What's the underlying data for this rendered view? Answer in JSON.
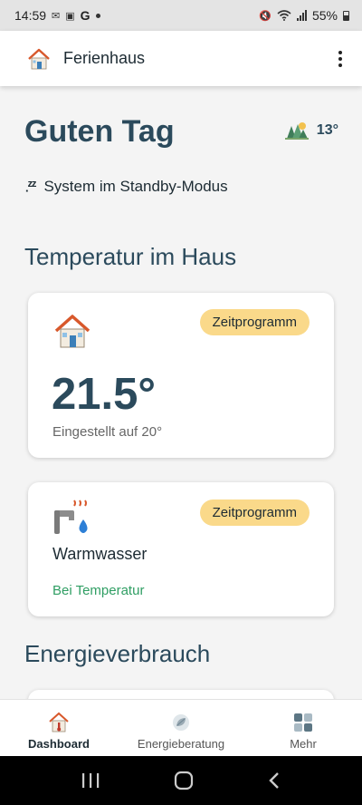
{
  "status_bar": {
    "time": "14:59",
    "g_label": "G",
    "battery": "55%"
  },
  "app_bar": {
    "title": "Ferienhaus",
    "home_icon": "house-icon",
    "menu_icon": "more-vertical-icon"
  },
  "header": {
    "greeting": "Guten Tag",
    "weather_icon": "forest-sun-icon",
    "outdoor_temp": "13°",
    "standby_icon": "sleep-zzz-icon",
    "standby_text": "System im Standby-Modus"
  },
  "sections": {
    "temperature_title": "Temperatur im Haus",
    "energy_title": "Energieverbrauch"
  },
  "house_card": {
    "icon": "house-icon",
    "badge": "Zeitprogramm",
    "temperature": "21.5°",
    "setpoint": "Eingestellt auf 20°"
  },
  "water_card": {
    "icon": "hot-water-tap-icon",
    "badge": "Zeitprogramm",
    "label": "Warmwasser",
    "status": "Bei Temperatur",
    "status_color": "#2f9e63"
  },
  "bottom_nav": {
    "items": [
      {
        "label": "Dashboard",
        "icon": "thermometer-house-icon",
        "active": true
      },
      {
        "label": "Energieberatung",
        "icon": "leaf-icon",
        "active": false
      },
      {
        "label": "Mehr",
        "icon": "grid-icon",
        "active": false
      }
    ]
  },
  "colors": {
    "primary_text": "#2b4a5c",
    "badge": "#fad98a",
    "background": "#f4f4f4"
  }
}
